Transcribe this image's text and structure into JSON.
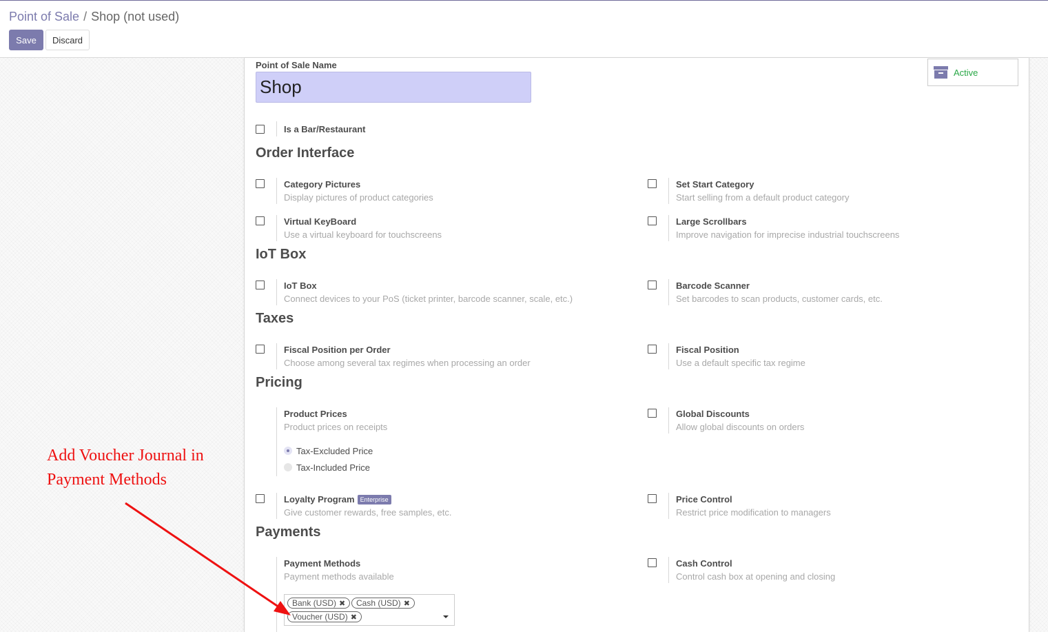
{
  "breadcrumb": {
    "parent": "Point of Sale",
    "separator": "/",
    "current": "Shop (not used)"
  },
  "toolbar": {
    "save_label": "Save",
    "discard_label": "Discard"
  },
  "form": {
    "name_label": "Point of Sale Name",
    "name_value": "Shop",
    "active_label": "Active",
    "is_bar_label": "Is a Bar/Restaurant"
  },
  "sections": {
    "order_interface": "Order Interface",
    "iot_box": "IoT Box",
    "taxes": "Taxes",
    "pricing": "Pricing",
    "payments": "Payments"
  },
  "options": {
    "category_pictures": {
      "title": "Category Pictures",
      "desc": "Display pictures of product categories"
    },
    "set_start_category": {
      "title": "Set Start Category",
      "desc": "Start selling from a default product category"
    },
    "virtual_keyboard": {
      "title": "Virtual KeyBoard",
      "desc": "Use a virtual keyboard for touchscreens"
    },
    "large_scrollbars": {
      "title": "Large Scrollbars",
      "desc": "Improve navigation for imprecise industrial touchscreens"
    },
    "iot_box": {
      "title": "IoT Box",
      "desc": "Connect devices to your PoS (ticket printer, barcode scanner, scale, etc.)"
    },
    "barcode_scanner": {
      "title": "Barcode Scanner",
      "desc": "Set barcodes to scan products, customer cards, etc."
    },
    "fiscal_position_per_order": {
      "title": "Fiscal Position per Order",
      "desc": "Choose among several tax regimes when processing an order"
    },
    "fiscal_position": {
      "title": "Fiscal Position",
      "desc": "Use a default specific tax regime"
    },
    "product_prices": {
      "title": "Product Prices",
      "desc": "Product prices on receipts"
    },
    "global_discounts": {
      "title": "Global Discounts",
      "desc": "Allow global discounts on orders"
    },
    "loyalty_program": {
      "title": "Loyalty Program",
      "badge": "Enterprise",
      "desc": "Give customer rewards, free samples, etc."
    },
    "price_control": {
      "title": "Price Control",
      "desc": "Restrict price modification to managers"
    },
    "payment_methods": {
      "title": "Payment Methods",
      "desc": "Payment methods available"
    },
    "cash_control": {
      "title": "Cash Control",
      "desc": "Control cash box at opening and closing"
    }
  },
  "price_radio": {
    "excluded": "Tax-Excluded Price",
    "included": "Tax-Included Price",
    "selected": "Tax-Excluded Price"
  },
  "payment_tags": [
    "Bank (USD)",
    "Cash (USD)",
    "Voucher (USD)"
  ],
  "annotation": {
    "line1": "Add Voucher Journal in",
    "line2": "Payment Methods"
  },
  "colors": {
    "accent": "#7c7bad",
    "annotation": "#ee1111",
    "active": "#28a745",
    "name_input_bg": "#cfcff8"
  }
}
